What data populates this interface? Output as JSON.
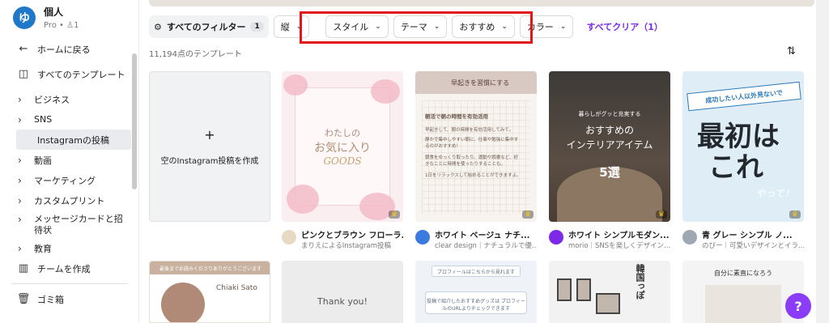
{
  "profile": {
    "initial": "ゆ",
    "name": "個人",
    "sub": "Pro • ♙1"
  },
  "nav": {
    "back": "ホームに戻る",
    "all_templates": "すべてのテンプレート",
    "business": "ビジネス",
    "sns": "SNS",
    "instagram": "Instagramの投稿",
    "video": "動画",
    "marketing": "マーケティング",
    "custom_print": "カスタムプリント",
    "message_card": "メッセージカードと招待状",
    "education": "教育",
    "create_team": "チームを作成",
    "trash": "ゴミ箱"
  },
  "filters": {
    "all_label": "すべてのフィルター",
    "all_count": "1",
    "orientation": "縦",
    "style": "スタイル",
    "theme": "テーマ",
    "recommended": "おすすめ",
    "color": "カラー",
    "clear_all": "すべてクリア（1）"
  },
  "result_count": "11,194点のテンプレート",
  "create_card": {
    "plus": "+",
    "label": "空のInstagram投稿を作成"
  },
  "cards": [
    {
      "title": "ピンクとブラウン フローラ...",
      "by": "まりえによるInstagram投稿",
      "lines": [
        "わたしの",
        "お気に入り",
        "GOODS"
      ],
      "avatar_color": "#e8d9c4"
    },
    {
      "title": "ホワイト ベージュ ナチ...",
      "by": "clear design｜ナチュラルで優...",
      "header": "早起きを習慣にする",
      "body": [
        "朝活で朝の時間を有効活用",
        "早起きして、朝の時間を有効活用してみて。",
        "静かで集中しやすい朝に、仕事や勉強に集中するのがおすすめ！",
        "朝食をゆっくり取ったり、運動や読書など、好きなことに時間を使ったりすることも。",
        "1日をリラックスして始めることができますよ。"
      ],
      "avatar_color": "#3b7be0"
    },
    {
      "title": "ホワイト シンプルモダン...",
      "by": "morio｜SNSを楽しくデザイン...",
      "small": "暮らしがグッと充実する",
      "main1": "おすすめの",
      "main2": "インテリアアイテム",
      "big": "5選",
      "avatar_color": "#7d2ae8"
    },
    {
      "title": "青 グレー シンプル ノ...",
      "by": "のびー｜可愛いデザインとイラ...",
      "ribbon": "成功したい人以外見ないで",
      "big1": "最初は",
      "big2": "これ",
      "small": "やって！",
      "avatar_color": "#9fa7b2"
    }
  ],
  "row2": {
    "a_band": "最後までお読みくださりありがとうございます",
    "a_name": "Chiaki Sato",
    "b_text": "Thank you!",
    "c_pill": "プロフィールはこちらから見れます",
    "c_box": "投稿で紹介したおすすめグッズは プロフィールのURLよりチェックできます",
    "d_text": "韓国っぽ",
    "e_text": "自分に素直になろう"
  },
  "colors": {
    "accent": "#7d2ae8",
    "highlight": "#e2151b",
    "help": "#8b3cf7"
  }
}
